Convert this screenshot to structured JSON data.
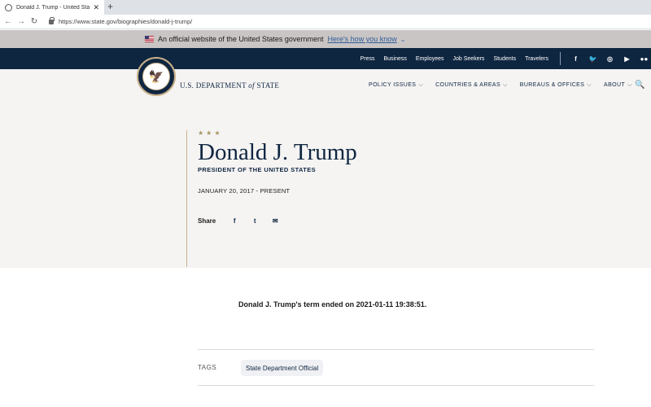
{
  "browser": {
    "tab_title": "Donald J. Trump - United States",
    "close_glyph": "✕",
    "newtab_glyph": "+",
    "url": "https://www.state.gov/biographies/donald-j-trump/",
    "back_glyph": "←",
    "forward_glyph": "→",
    "reload_glyph": "↻"
  },
  "gov_banner": {
    "text": "An official website of the United States government",
    "link": "Here's how you know",
    "chevron": "⌄"
  },
  "util_links": [
    "Press",
    "Business",
    "Employees",
    "Job Seekers",
    "Students",
    "Travelers"
  ],
  "social_icons": [
    {
      "name": "facebook-icon",
      "glyph": "f"
    },
    {
      "name": "twitter-icon",
      "glyph": "🐦"
    },
    {
      "name": "instagram-icon",
      "glyph": "◎"
    },
    {
      "name": "youtube-icon",
      "glyph": "▶"
    },
    {
      "name": "flickr-icon",
      "glyph": "●●"
    }
  ],
  "header": {
    "dept_prefix": "U.S. DEPARTMENT ",
    "dept_of": "of",
    "dept_suffix": " STATE",
    "seal_glyph": "🦅",
    "nav": [
      {
        "label": "POLICY ISSUES",
        "dd": "⌵"
      },
      {
        "label": "COUNTRIES & AREAS",
        "dd": "⌵"
      },
      {
        "label": "BUREAUS & OFFICES",
        "dd": "⌵"
      },
      {
        "label": "ABOUT",
        "dd": "⌵"
      }
    ],
    "search_glyph": "🔍"
  },
  "bio": {
    "stars": "★★★",
    "name": "Donald J. Trump",
    "role": "PRESIDENT OF THE UNITED STATES",
    "dates": "JANUARY 20, 2017 - PRESENT",
    "share_label": "Share",
    "share_facebook": "f",
    "share_twitter": "t",
    "share_email": "✉"
  },
  "content": {
    "term_note": "Donald J. Trump's term ended on 2021-01-11 19:38:51.",
    "tags_label": "TAGS",
    "tag": "State Department Official"
  },
  "colors": {
    "navy": "#0f2641",
    "gold": "#c8b08a",
    "banner_gray": "#c9c5c4"
  }
}
